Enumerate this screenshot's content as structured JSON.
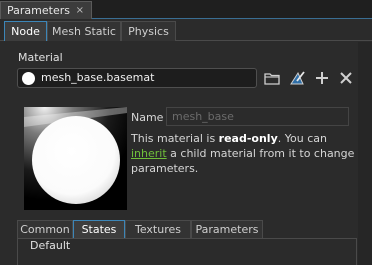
{
  "window": {
    "tab_label": "Parameters",
    "close_glyph": "×"
  },
  "tabs": [
    {
      "label": "Node",
      "active": true
    },
    {
      "label": "Mesh Static",
      "active": false
    },
    {
      "label": "Physics",
      "active": false
    }
  ],
  "material": {
    "section_label": "Material",
    "value": "mesh_base.basemat",
    "icons": [
      "folder-icon",
      "edit-material-icon",
      "add-icon",
      "clear-icon"
    ]
  },
  "details": {
    "name_label": "Name",
    "name_placeholder": "mesh_base",
    "info_prefix": "This material is ",
    "info_bold": "read-only",
    "info_mid": ". You can ",
    "info_link": "inherit",
    "info_suffix": " a child material from it to change parameters."
  },
  "bottom_tabs": [
    {
      "label": "Common",
      "active": false
    },
    {
      "label": "States",
      "active": true
    },
    {
      "label": "Textures",
      "active": false
    },
    {
      "label": "Parameters",
      "active": false
    }
  ],
  "group": {
    "title": "Default"
  },
  "colors": {
    "accent": "#3c86b8",
    "link": "#6fbf3a",
    "background": "#2b2b2b"
  }
}
